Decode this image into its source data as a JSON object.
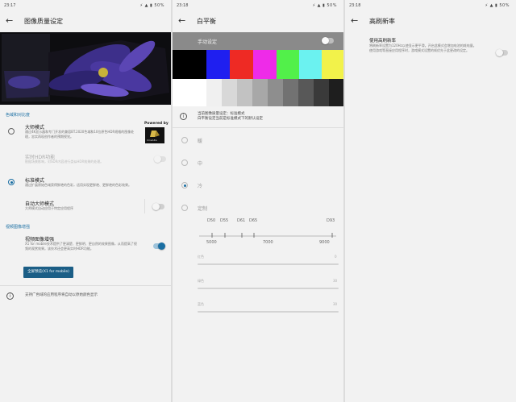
{
  "panel1": {
    "status": {
      "time": "23:17",
      "system": "⚡ ▲ ▮ 50%"
    },
    "title": "图像质量设定",
    "section_color": "色域和对比度",
    "creator": {
      "label": "大师模式",
      "desc": "通过4K显示器和专门开发的兼容BT.2020色域和10位原色HDR规格的图像处理，忠实再现创作者的预期视觉。",
      "powered_by": "Powered by",
      "logo_text": "CineAlta"
    },
    "hdr": {
      "label": "实时HDR功能",
      "desc": "根据场景影响，对SDR内容进行类似HDR效果的处理。"
    },
    "standard": {
      "label": "标准模式",
      "desc": "通过扩展原始色域获得鲜艳的色彩，适用实现更鲜艳、更鲜艳的色彩效果。"
    },
    "auto_creator": {
      "label": "自动大师模式",
      "desc": "大师模式自动应用于特定应用程序"
    },
    "section_video": "视频图像增强",
    "video": {
      "label": "视频图像增强",
      "desc": "X1 for mobile技术提供了更清楚、更鲜明、更自然的效果图像，从而提高了视频的观赏效果。该技术还会更高实时HDR功能。"
    },
    "preview_button": "全屏预览(X1 for mobile)",
    "info_text": "支持广色域的应用程序将自动以原始颜色显示"
  },
  "panel2": {
    "status": {
      "time": "23:18",
      "system": "⚡ ▲ ▮ 50%"
    },
    "title": "白平衡",
    "manual_label": "手动设定",
    "info_text": "当前图像质量设定：标准模式\n白平衡设定当前是标准模式下的默认设定",
    "options": [
      "暖",
      "中",
      "冷",
      "定制"
    ],
    "kelvin_ticks": [
      "D50",
      "D55",
      "D61",
      "D65",
      "D93"
    ],
    "kelvin_scale": [
      "5000",
      "7000",
      "9000"
    ],
    "sliders": [
      {
        "label": "红色",
        "value": "0"
      },
      {
        "label": "绿色",
        "value": "30"
      },
      {
        "label": "蓝色",
        "value": "30"
      }
    ]
  },
  "panel3": {
    "status": {
      "time": "23:18",
      "system": "⚡ ▲ ▮ 50%"
    },
    "title": "高刷新率",
    "setting_label": "使用高刷新率",
    "setting_desc": "将刷新率设置为120Hz以使显示更平滑。开启此模式会增加电池的耗电量。\n使用游戏等直接应用程序时，游戏模式设置的帧优先于此更改的设定。"
  },
  "colors": {
    "accent": "#1b6fa3",
    "button": "#1b5e86"
  }
}
